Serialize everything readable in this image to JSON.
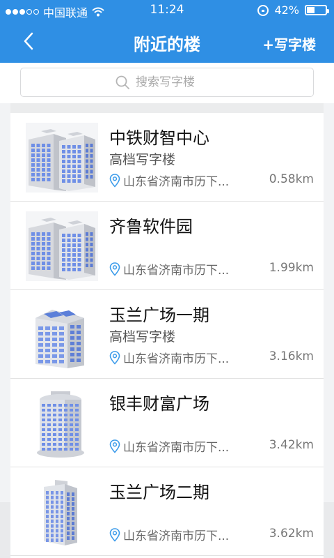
{
  "status": {
    "carrier": "中国联通",
    "time": "11:24",
    "battery_text": "42%",
    "battery_level": 0.42
  },
  "nav": {
    "title": "附近的楼",
    "action_label": "+写字楼",
    "back_icon": "chevron-left-icon"
  },
  "search": {
    "placeholder": "搜索写字楼",
    "icon": "search-icon"
  },
  "buildings": [
    {
      "name": "中铁财智中心",
      "tag": "高档写字楼",
      "address": "山东省济南市历下...",
      "distance": "0.58km",
      "image": "twin-building-image"
    },
    {
      "name": "齐鲁软件园",
      "tag": "",
      "address": "山东省济南市历下...",
      "distance": "1.99km",
      "image": "twin-building-image"
    },
    {
      "name": "玉兰广场一期",
      "tag": "高档写字楼",
      "address": "山东省济南市历下...",
      "distance": "3.16km",
      "image": "solar-building-image"
    },
    {
      "name": "银丰财富广场",
      "tag": "",
      "address": "山东省济南市历下...",
      "distance": "3.42km",
      "image": "round-tower-image"
    },
    {
      "name": "玉兰广场二期",
      "tag": "",
      "address": "山东省济南市历下...",
      "distance": "3.62km",
      "image": "slim-tower-image"
    }
  ],
  "colors": {
    "nav_bg": "#2f8fe4",
    "pin": "#3b9bea",
    "building_glass": "#6f8fe6"
  }
}
